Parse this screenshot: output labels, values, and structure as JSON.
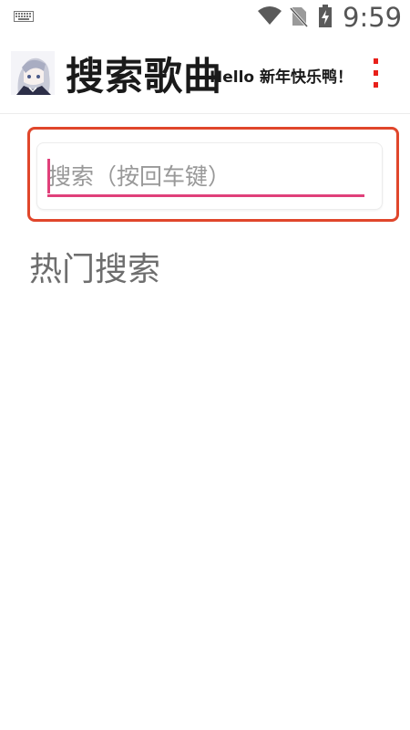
{
  "status_bar": {
    "time": "9:59",
    "icons": [
      "keyboard-icon",
      "wifi-icon",
      "no-sim-icon",
      "battery-charging-icon"
    ]
  },
  "app_bar": {
    "title": "搜索歌曲",
    "marquee": "Hello 新年快乐鸭！",
    "menu_icon": "more-vert-icon",
    "menu_color": "#e8201a"
  },
  "search": {
    "placeholder": "搜索（按回车键）",
    "value": "",
    "accent_color": "#e0407a",
    "highlight_color": "#e0462b"
  },
  "hot_search": {
    "title": "热门搜索"
  }
}
